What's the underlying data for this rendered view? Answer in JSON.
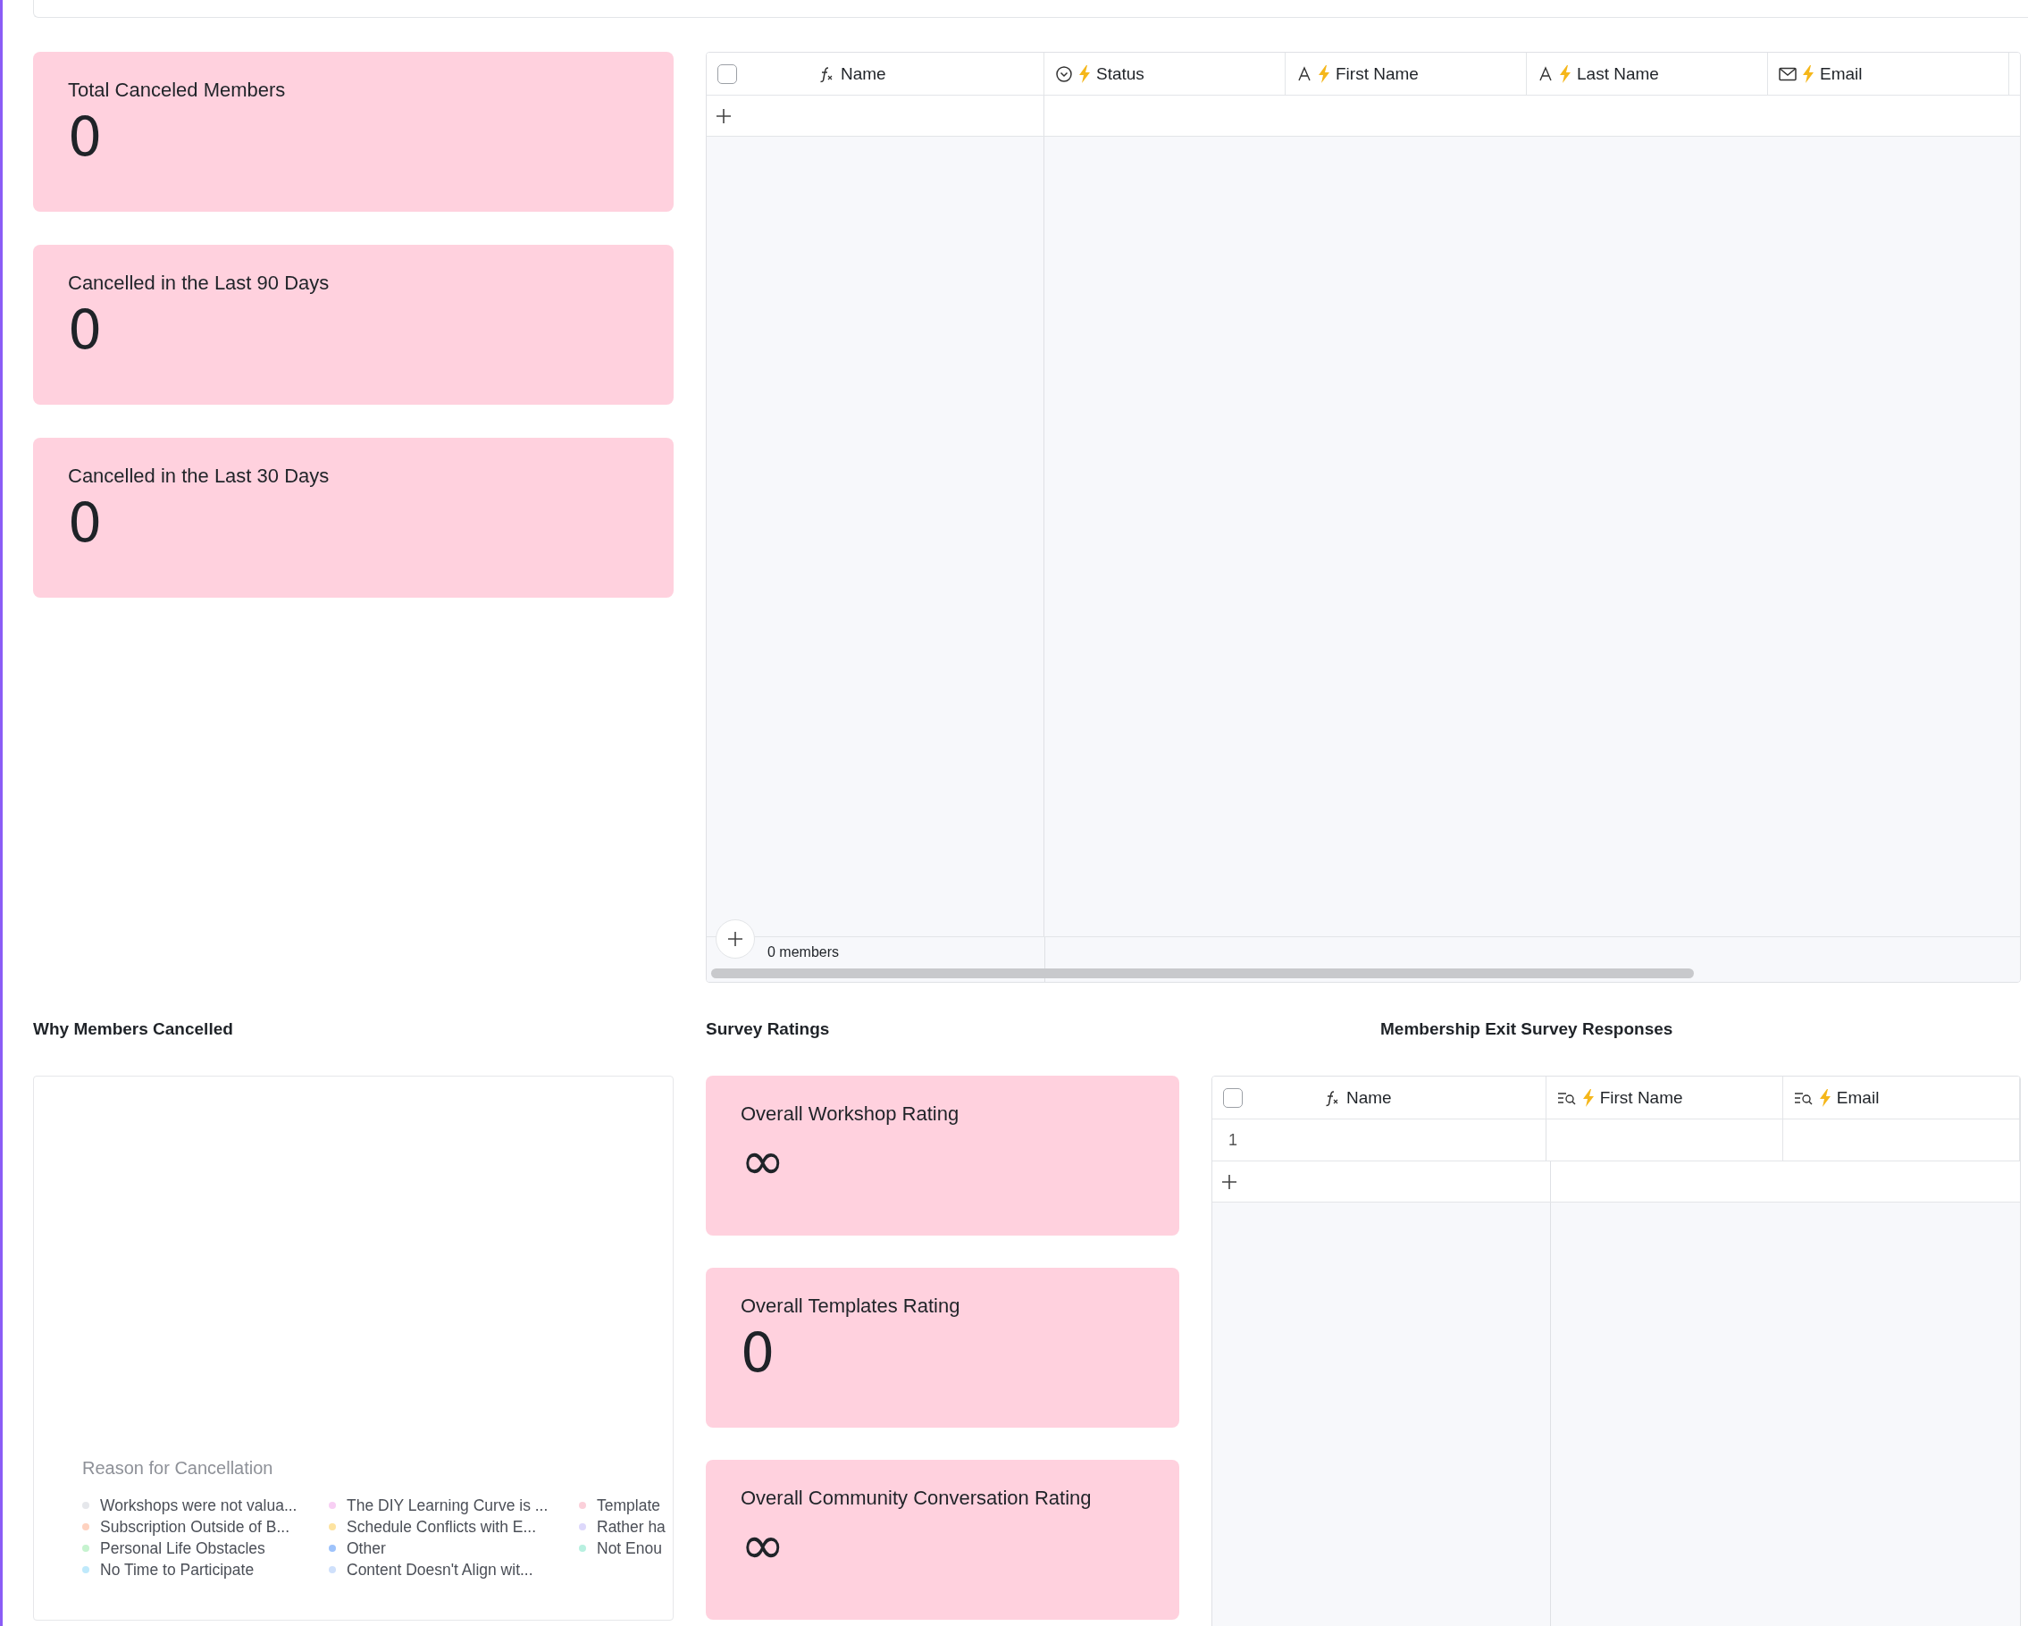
{
  "stat_cards": [
    {
      "title": "Total Canceled Members",
      "value": "0"
    },
    {
      "title": "Cancelled in the Last 90 Days",
      "value": "0"
    },
    {
      "title": "Cancelled in the Last 30 Days",
      "value": "0"
    }
  ],
  "members_table": {
    "select_all": {
      "checked": false
    },
    "columns": [
      {
        "label": "Name",
        "kind": "formula",
        "automated": false
      },
      {
        "label": "Status",
        "kind": "status",
        "automated": true
      },
      {
        "label": "First Name",
        "kind": "text",
        "automated": true
      },
      {
        "label": "Last Name",
        "kind": "text",
        "automated": true
      },
      {
        "label": "Email",
        "kind": "email",
        "automated": true
      }
    ],
    "footer": "0 members"
  },
  "sections": {
    "reasons_title": "Why Members Cancelled",
    "survey_title": "Survey Ratings",
    "responses_title": "Membership Exit Survey Responses"
  },
  "reasons_chart": {
    "legend_title": "Reason for Cancellation",
    "items": [
      {
        "label": "Workshops were not valua...",
        "color": "#e5e7eb"
      },
      {
        "label": "Subscription Outside of B...",
        "color": "#fed2c0"
      },
      {
        "label": "Personal Life Obstacles",
        "color": "#c6f3cf"
      },
      {
        "label": "No Time to Participate",
        "color": "#bfe9fb"
      },
      {
        "label": "The DIY Learning Curve is ...",
        "color": "#f8cff4"
      },
      {
        "label": "Schedule Conflicts with E...",
        "color": "#fde3a0"
      },
      {
        "label": "Other",
        "color": "#9ec3fb"
      },
      {
        "label": "Content Doesn't Align wit...",
        "color": "#cfe0fb"
      },
      {
        "label": "Template",
        "color": "#fbd0da"
      },
      {
        "label": "Rather ha",
        "color": "#ddd8fb"
      },
      {
        "label": "Not Enou",
        "color": "#b8f0e0"
      }
    ]
  },
  "survey_cards": [
    {
      "title": "Overall Workshop Rating",
      "value": "∞"
    },
    {
      "title": "Overall Templates Rating",
      "value": "0"
    },
    {
      "title": "Overall Community Conversation Rating",
      "value": "∞"
    }
  ],
  "responses_table": {
    "select_all": {
      "checked": false
    },
    "columns": [
      {
        "label": "Name",
        "kind": "formula",
        "automated": false
      },
      {
        "label": "First Name",
        "kind": "lookup",
        "automated": true
      },
      {
        "label": "Email",
        "kind": "lookup",
        "automated": true
      }
    ],
    "rows": [
      {
        "number": "1"
      }
    ]
  }
}
